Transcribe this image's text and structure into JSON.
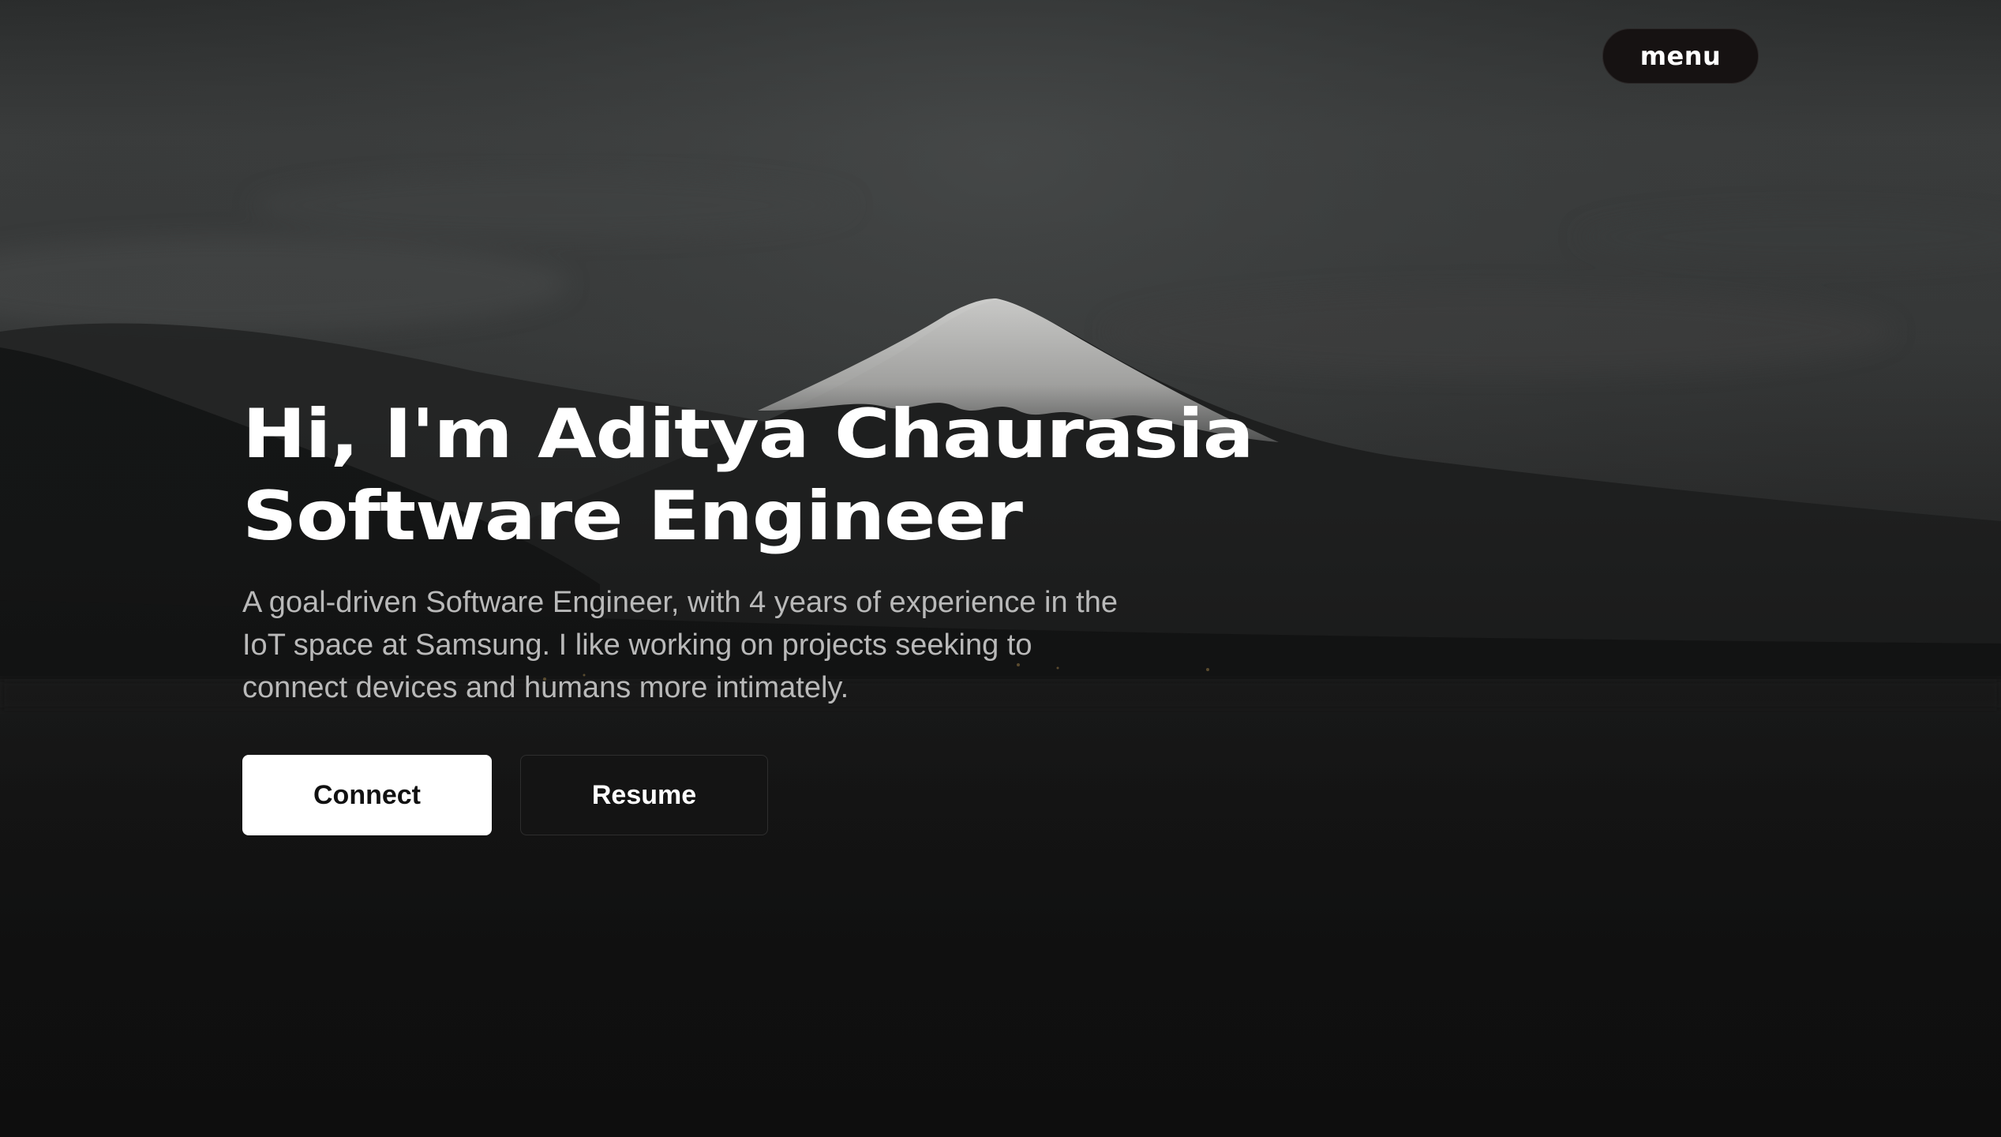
{
  "header": {
    "menu_label": "menu"
  },
  "hero": {
    "title_line1": "Hi, I'm Aditya Chaurasia",
    "title_line2": "Software Engineer",
    "description": "A goal-driven Software Engineer, with 4 years of experience in the IoT space at Samsung. I like working on projects seeking to connect devices and humans more intimately."
  },
  "actions": {
    "connect_label": "Connect",
    "resume_label": "Resume"
  },
  "colors": {
    "background": "#121212",
    "primary_button": "#ffffff",
    "secondary_button": "#141414",
    "menu_button": "#161212",
    "description_text": "#b9b9b9"
  }
}
